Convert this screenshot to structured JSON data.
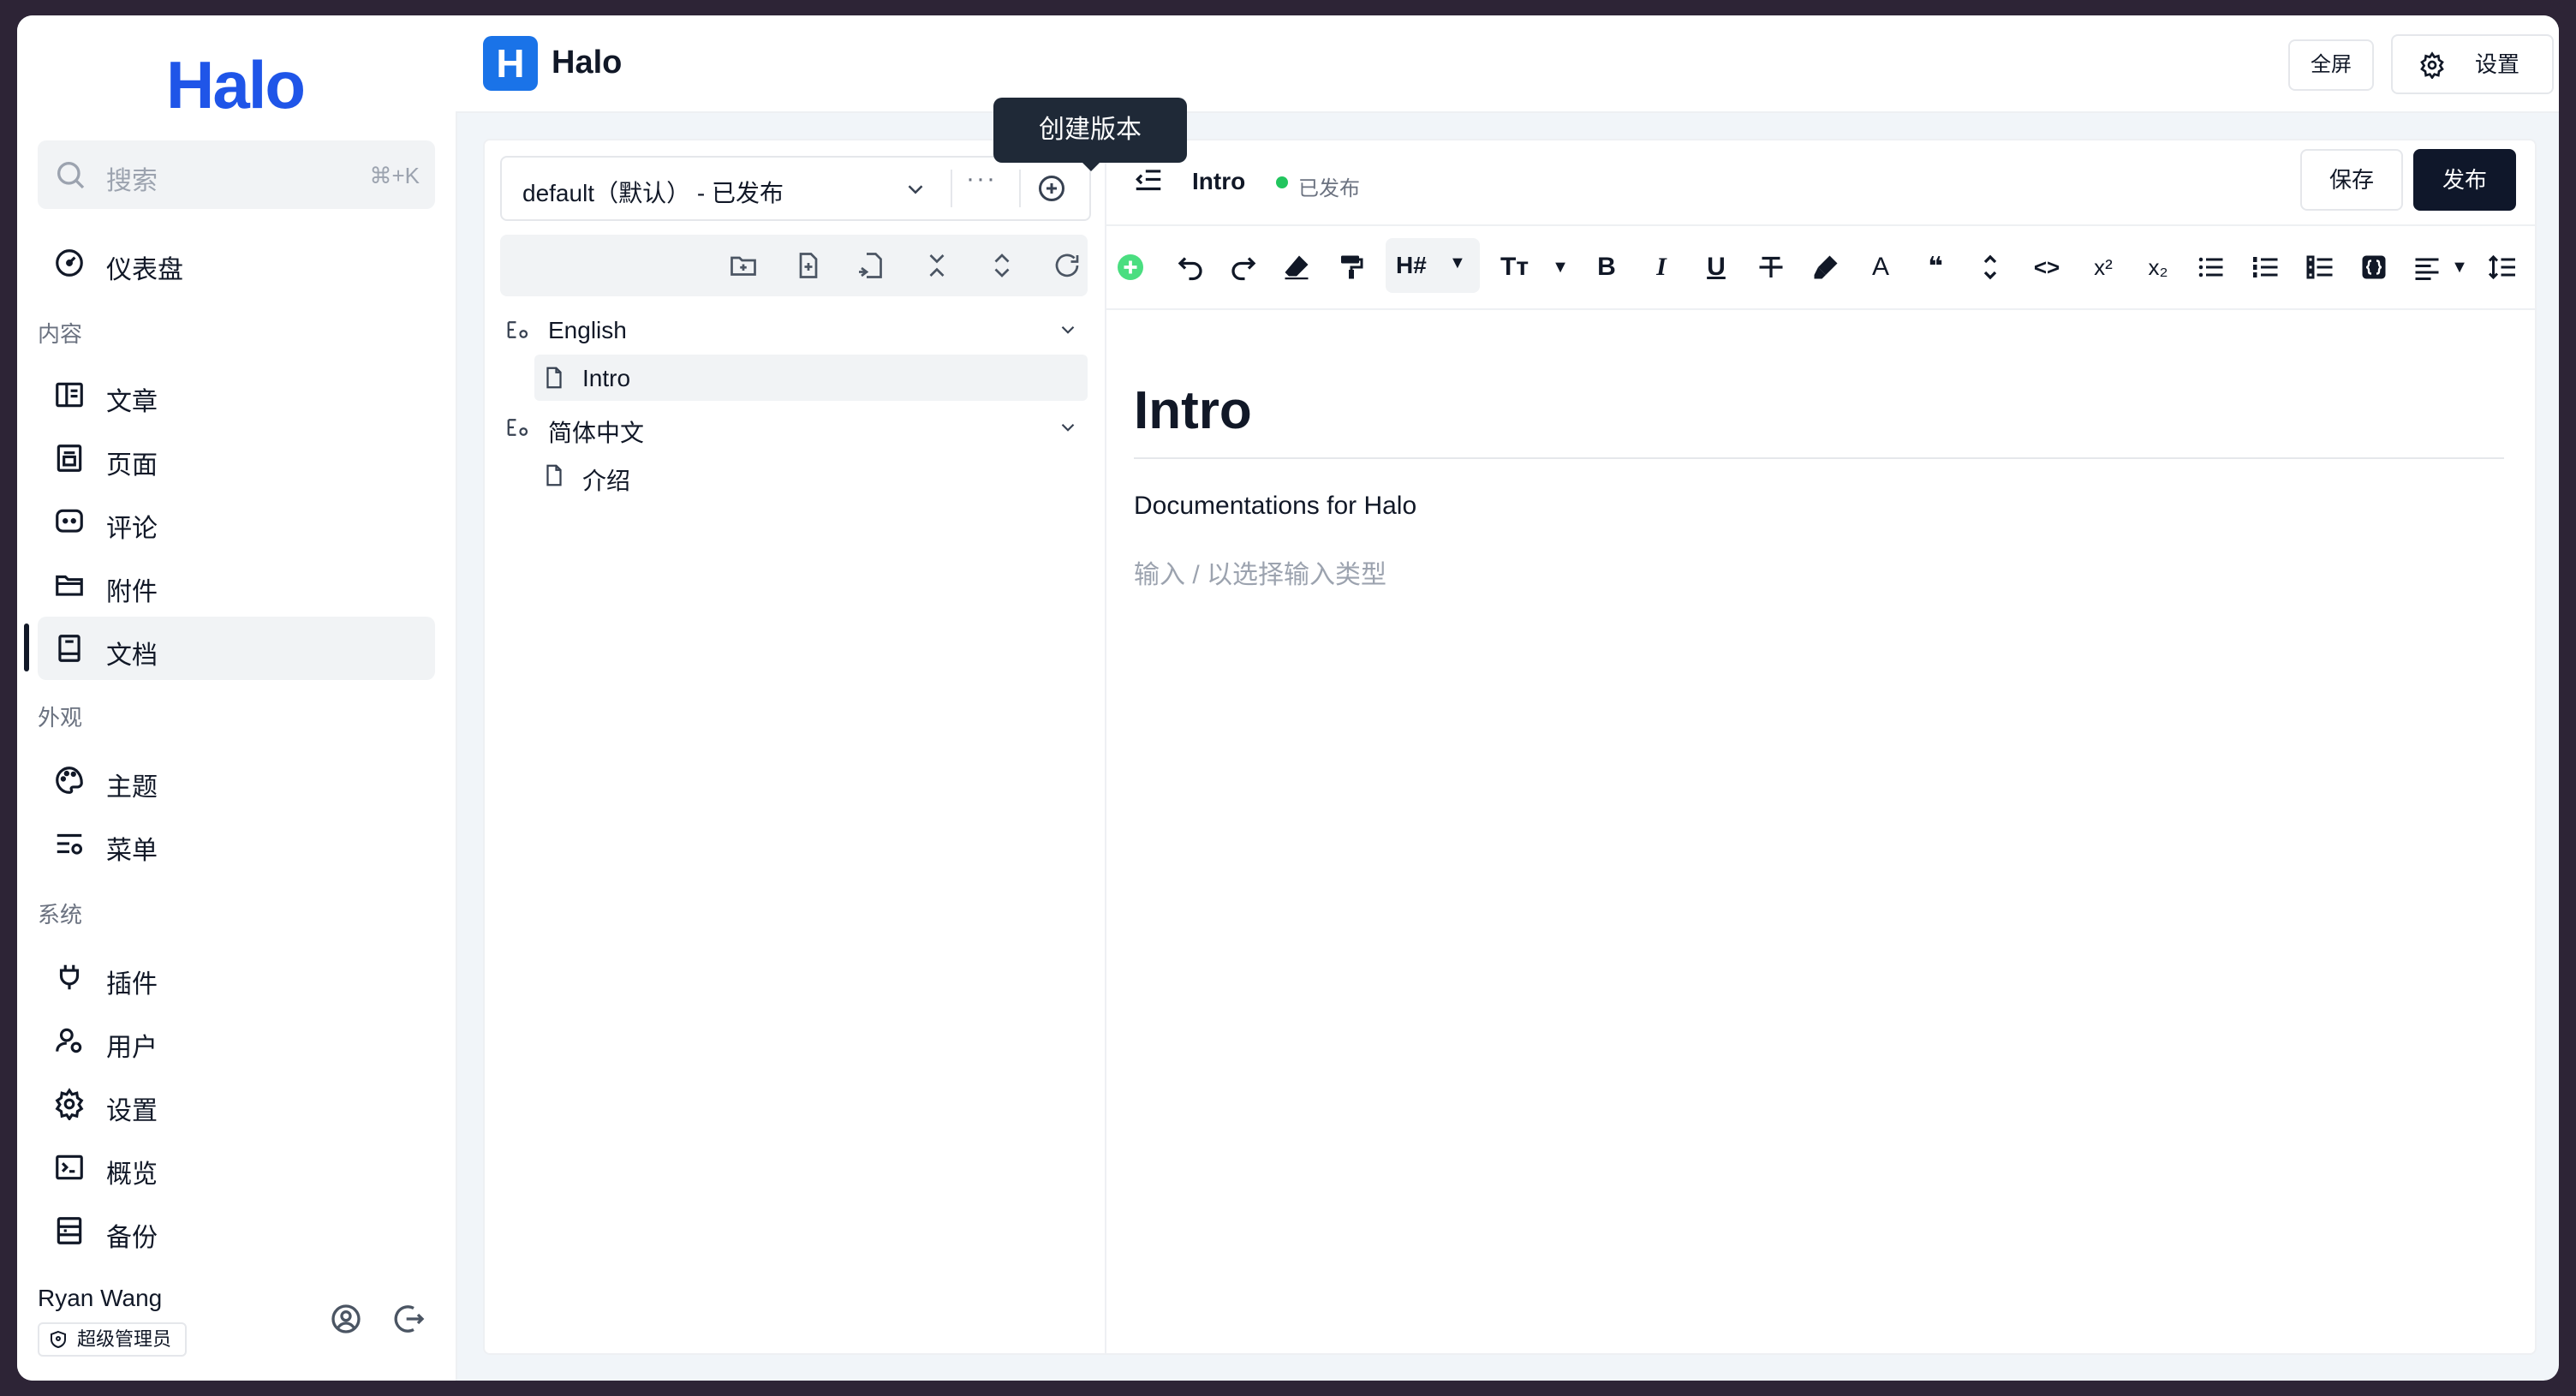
{
  "sidebar": {
    "logo": "Halo",
    "search": {
      "placeholder": "搜索",
      "shortcut": "⌘+K"
    },
    "items": [
      {
        "label": "仪表盘",
        "icon": "dashboard-icon"
      },
      {
        "label": "文章",
        "icon": "book-open-icon"
      },
      {
        "label": "页面",
        "icon": "page-icon"
      },
      {
        "label": "评论",
        "icon": "comment-icon"
      },
      {
        "label": "附件",
        "icon": "folder-icon"
      },
      {
        "label": "文档",
        "icon": "book-icon"
      },
      {
        "label": "主题",
        "icon": "palette-icon"
      },
      {
        "label": "菜单",
        "icon": "menu-settings-icon"
      },
      {
        "label": "插件",
        "icon": "plug-icon"
      },
      {
        "label": "用户",
        "icon": "user-icon"
      },
      {
        "label": "设置",
        "icon": "gear-icon"
      },
      {
        "label": "概览",
        "icon": "terminal-icon"
      },
      {
        "label": "备份",
        "icon": "backup-icon"
      }
    ],
    "sections": {
      "content": "内容",
      "appearance": "外观",
      "system": "系统"
    },
    "active_item": "文档",
    "user": {
      "name": "Ryan Wang",
      "role": "超级管理员"
    }
  },
  "header": {
    "app_icon_letter": "H",
    "app_name": "Halo",
    "fullscreen_label": "全屏",
    "settings_label": "设置"
  },
  "docs": {
    "version_select": "default（默认） - 已发布",
    "more_label": "···",
    "tooltip": "创建版本",
    "tree": [
      {
        "label": "English",
        "type": "group",
        "expanded": true
      },
      {
        "label": "Intro",
        "type": "doc",
        "selected": true
      },
      {
        "label": "简体中文",
        "type": "group",
        "expanded": true
      },
      {
        "label": "介绍",
        "type": "doc",
        "selected": false
      }
    ]
  },
  "editor": {
    "title": "Intro",
    "status": "已发布",
    "status_color": "#22c55e",
    "save_label": "保存",
    "publish_label": "发布",
    "toolbar": {
      "heading": "H#",
      "text_size": "Tт",
      "bold": "B",
      "italic": "I",
      "underline": "U",
      "font_color": "A",
      "quote": "❝",
      "code": "<>",
      "superscript": "x²",
      "subscript": "x₂"
    },
    "doc_heading": "Intro",
    "doc_paragraph": "Documentations for Halo",
    "placeholder": "输入 / 以选择输入类型"
  }
}
